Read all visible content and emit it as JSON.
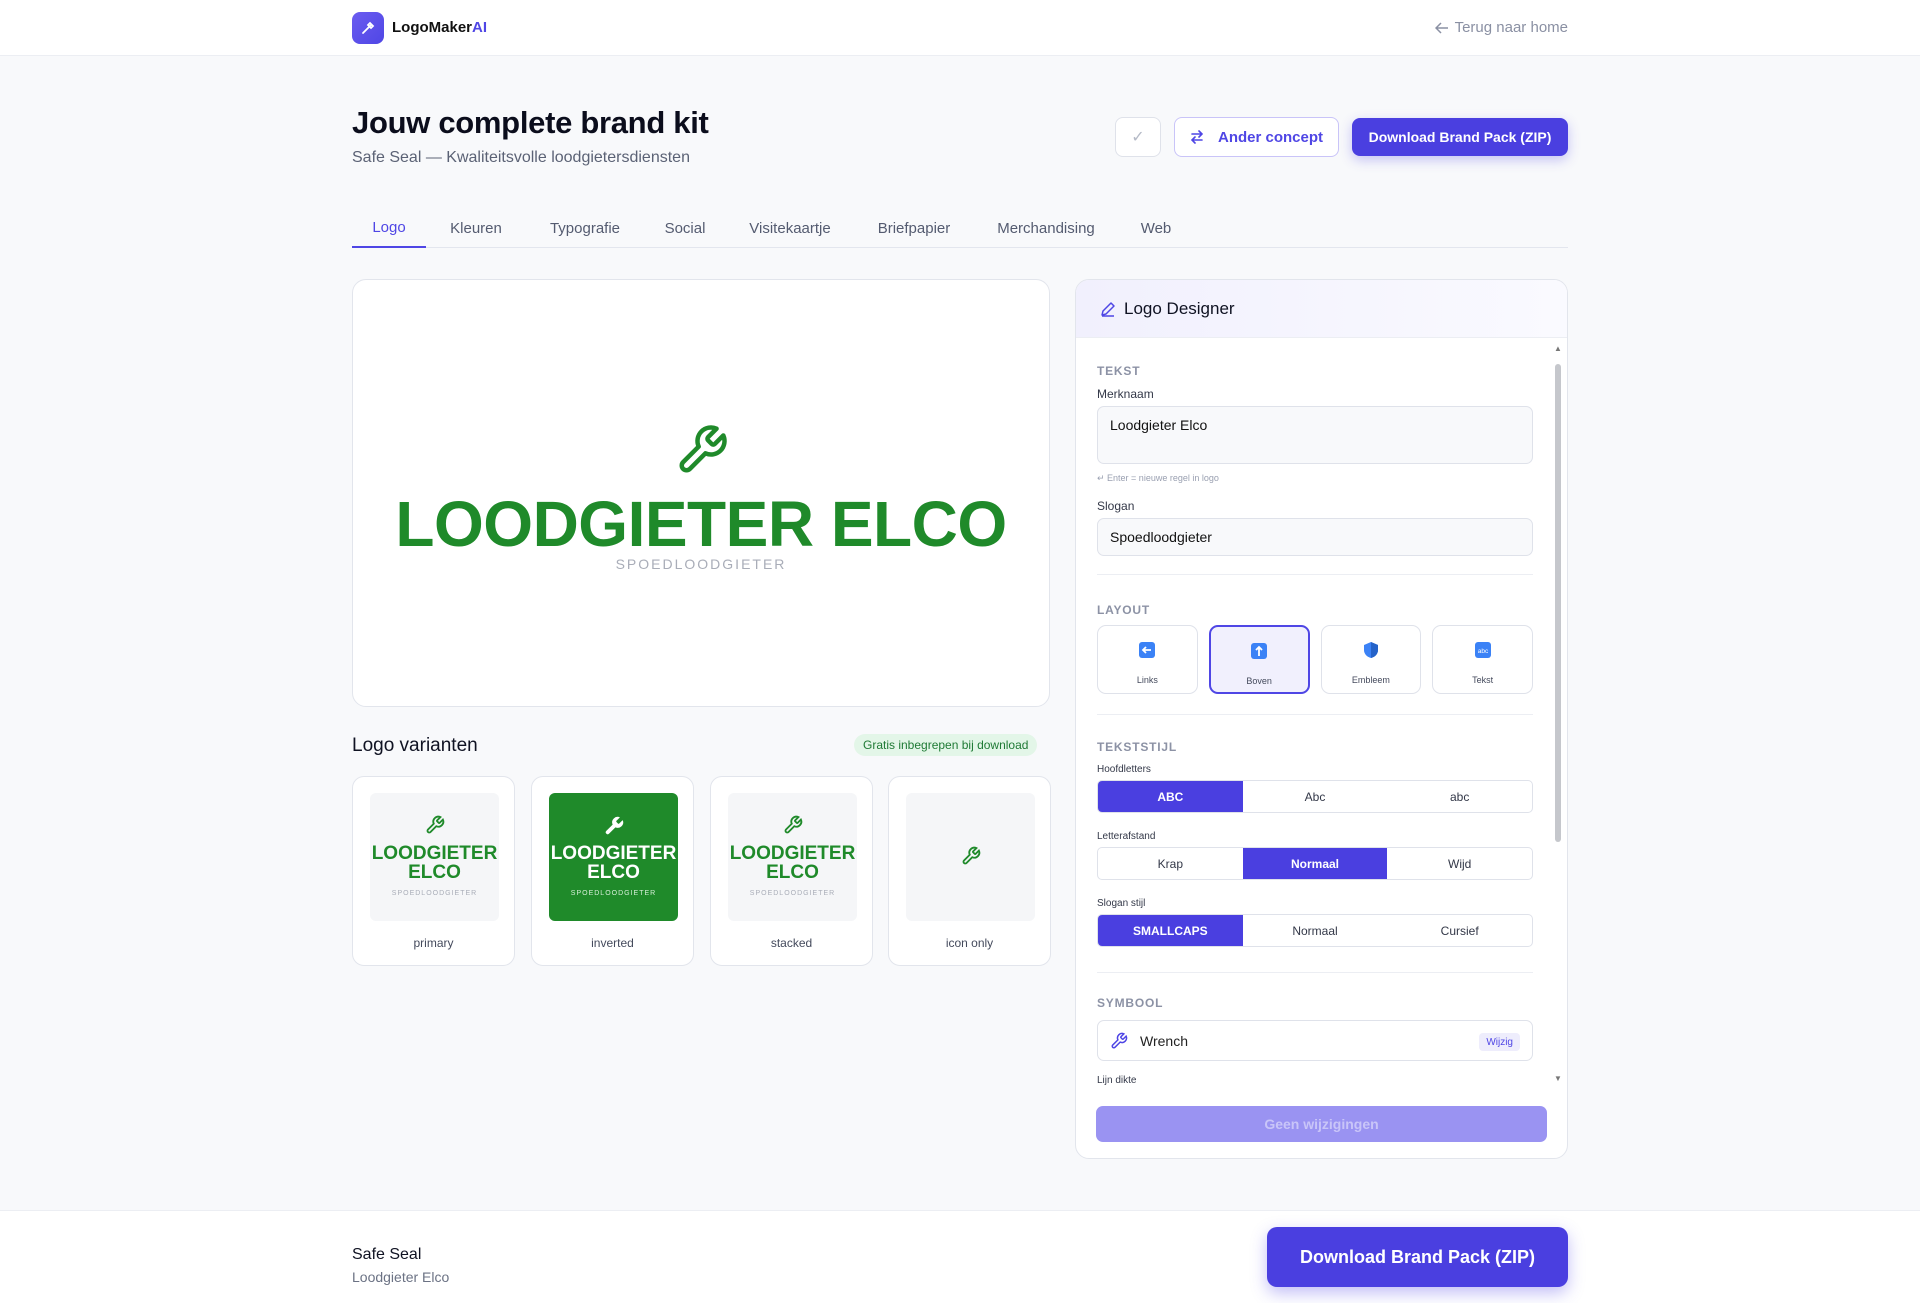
{
  "header": {
    "brand_main": "LogoMaker",
    "brand_ai": "AI",
    "back_label": "Terug naar home"
  },
  "hero": {
    "title": "Jouw complete brand kit",
    "subtitle": "Safe Seal — Kwaliteitsvolle loodgietersdiensten",
    "check_label": "✓",
    "concept_label": "Ander concept",
    "download_label": "Download Brand Pack (ZIP)"
  },
  "tabs": [
    "Logo",
    "Kleuren",
    "Typografie",
    "Social",
    "Visitekaartje",
    "Briefpapier",
    "Merchandising",
    "Web"
  ],
  "preview": {
    "name": "LOODGIETER ELCO",
    "slogan": "SPOEDLOODGIETER",
    "brand_color": "#1f8a2a"
  },
  "variants": {
    "title": "Logo varianten",
    "badge": "Gratis inbegrepen bij download",
    "name_line1": "LOODGIETER",
    "name_line2": "ELCO",
    "slogan": "SPOEDLOODGIETER",
    "items": [
      {
        "label": "primary"
      },
      {
        "label": "inverted"
      },
      {
        "label": "stacked"
      },
      {
        "label": "icon only"
      }
    ]
  },
  "designer": {
    "title": "Logo Designer",
    "tekst_section": "TEKST",
    "merknaam_label": "Merknaam",
    "merknaam_value": "Loodgieter Elco",
    "merknaam_hint": "↵ Enter = nieuwe regel in logo",
    "slogan_label": "Slogan",
    "slogan_value": "Spoedloodgieter",
    "layout_section": "LAYOUT",
    "layout_options": [
      "Links",
      "Boven",
      "Embleem",
      "Tekst"
    ],
    "tekststijl_section": "TEKSTSTIJL",
    "hoofdletters_label": "Hoofdletters",
    "hoofdletters_options": [
      "ABC",
      "Abc",
      "abc"
    ],
    "letterafstand_label": "Letterafstand",
    "letterafstand_options": [
      "Krap",
      "Normaal",
      "Wijd"
    ],
    "slogan_stijl_label": "Slogan stijl",
    "slogan_stijl_options": [
      "SMALLCAPS",
      "Normaal",
      "Cursief"
    ],
    "symbool_section": "SYMBOOL",
    "symbol_name": "Wrench",
    "symbol_change": "Wijzig",
    "lijn_dikte_label": "Lijn dikte",
    "apply_label": "Geen wijzigingen"
  },
  "footer": {
    "name": "Safe Seal",
    "sub": "Loodgieter Elco",
    "download_label": "Download Brand Pack (ZIP)"
  }
}
